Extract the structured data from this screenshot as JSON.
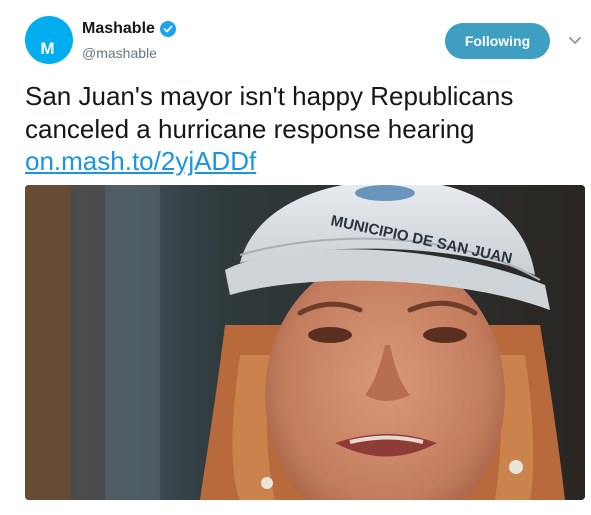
{
  "account": {
    "name": "Mashable",
    "handle": "@mashable",
    "avatar_letter": "M",
    "verified": true,
    "brand_color": "#00aeef"
  },
  "actions": {
    "follow_label": "Following",
    "follow_color": "#3f9fc2",
    "menu_icon": "chevron-down-icon"
  },
  "tweet": {
    "text": "San Juan's mayor isn't happy Republicans canceled a hurricane response hearing",
    "link": "on.mash.to/2yjADDf",
    "link_color": "#1b95e0"
  },
  "media": {
    "type": "photo",
    "cap_text": "MUNICIPIO DE SAN JUAN"
  }
}
